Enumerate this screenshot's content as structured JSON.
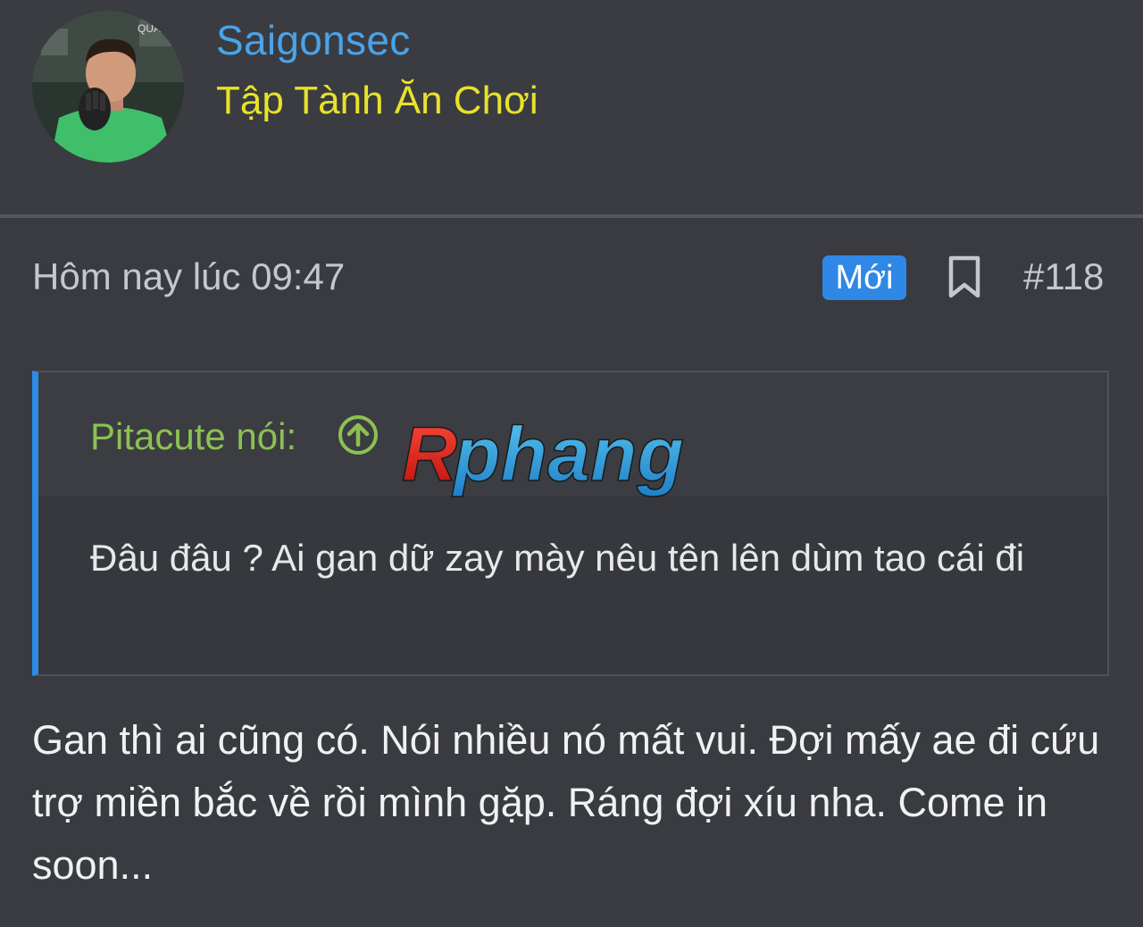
{
  "user": {
    "name": "Saigonsec",
    "title": "Tập Tành Ăn Chơi",
    "avatar_icon": "avatar-photo",
    "name_color": "#4aa3e8",
    "title_color": "#e8e22a"
  },
  "post": {
    "time": "Hôm nay lúc 09:47",
    "badge": "Mới",
    "badge_color": "#2f88e6",
    "number": "#118",
    "bookmark_icon": "bookmark-icon"
  },
  "quote": {
    "author": "Pitacute nói:",
    "author_color": "#8cc152",
    "arrow_icon": "circle-arrow-up-icon",
    "text": "Đâu đâu ? Ai gan dữ zay mày nêu tên lên dùm tao cái đi"
  },
  "watermark": {
    "text": "Rphang"
  },
  "body": {
    "text": "Gan thì ai cũng có. Nói nhiều nó mất vui. Đợi mấy ae đi cứu trợ miền bắc về rồi mình gặp. Ráng đợi xíu nha. Come in soon..."
  }
}
